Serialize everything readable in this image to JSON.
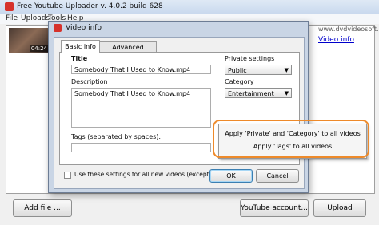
{
  "main_window": {
    "title": "Free Youtube Uploader  v. 4.0.2 build 628",
    "menu": [
      "File",
      "Uploads",
      "Tools",
      "Help"
    ],
    "brand_link": "www.dvdvideosoft.com",
    "video_info_link": "Video info",
    "thumbnail_duration": "04:24",
    "buttons": {
      "add_file": "Add file ...",
      "youtube_account": "YouTube account...",
      "upload": "Upload"
    }
  },
  "dialog": {
    "title": "Video info",
    "tabs": [
      "Basic info",
      "Advanced settings"
    ],
    "title_label": "Title",
    "title_value": "Somebody That I Used to Know.mp4",
    "description_label": "Description",
    "description_value": "Somebody That I Used to Know.mp4",
    "tags_label": "Tags (separated by spaces):",
    "tags_value": "",
    "private_label": "Private settings",
    "private_value": "Public",
    "category_label": "Category",
    "category_value": "Entertainment",
    "use_settings_label": "Use these settings for all new videos (except 'Title')",
    "use_settings_checked": false,
    "ok": "OK",
    "cancel": "Cancel"
  },
  "context_menu": {
    "items": [
      "Apply 'Private' and 'Category' to all videos",
      "Apply 'Tags' to all videos"
    ]
  },
  "colors": {
    "highlight": "#ee8a2a",
    "link": "#0000cc",
    "app_icon": "#d6322b"
  }
}
